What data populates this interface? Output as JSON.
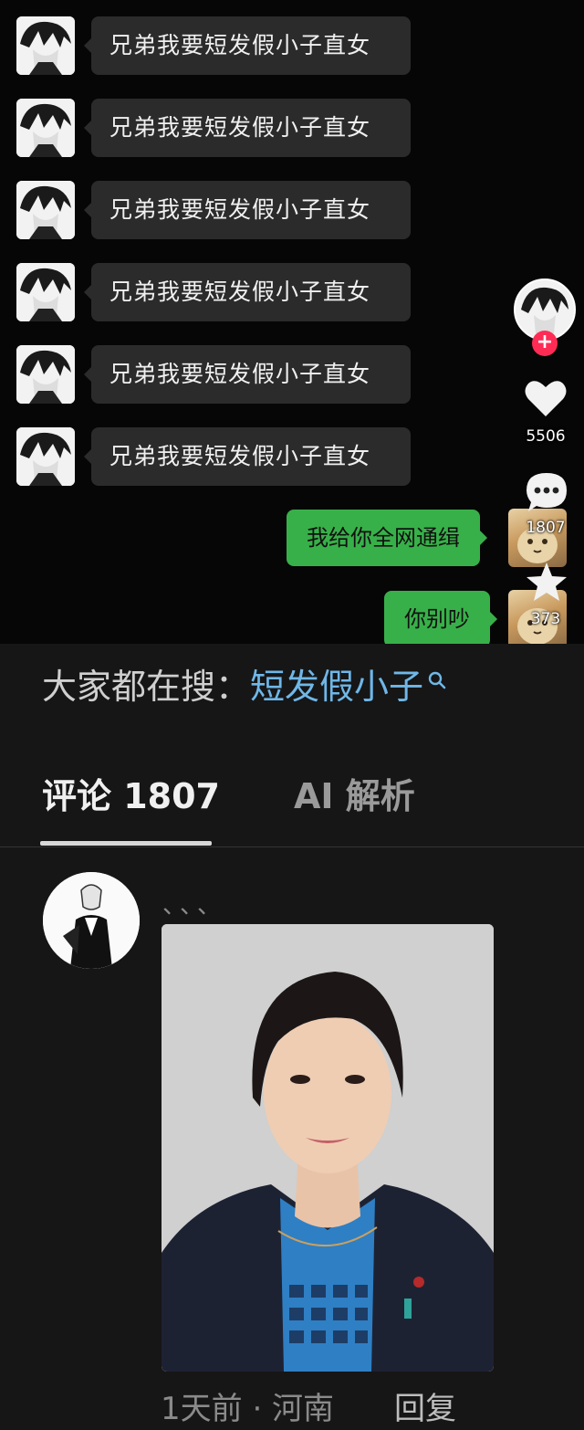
{
  "chat": {
    "left_messages": [
      {
        "text": "兄弟我要短发假小子直女"
      },
      {
        "text": "兄弟我要短发假小子直女"
      },
      {
        "text": "兄弟我要短发假小子直女"
      },
      {
        "text": "兄弟我要短发假小子直女"
      },
      {
        "text": "兄弟我要短发假小子直女"
      },
      {
        "text": "兄弟我要短发假小子直女"
      }
    ],
    "right_messages": [
      {
        "text": "我给你全网通缉"
      },
      {
        "text": "你别吵"
      }
    ]
  },
  "actions": {
    "follow_symbol": "+",
    "like_count": "5506",
    "comment_count": "1807",
    "favorite_count": "373",
    "like_icon": "heart-icon",
    "comment_icon": "comment-bubble-icon",
    "favorite_icon": "star-icon"
  },
  "search_suggestion": {
    "prefix": "大家都在搜：",
    "term": "短发假小子",
    "icon": "search-icon"
  },
  "tabs": {
    "comments": "评论 1807",
    "ai": "AI 解析"
  },
  "comment": {
    "username": "、、、",
    "meta": "1天前 · 河南",
    "reply": "回复"
  },
  "colors": {
    "accent_red": "#fe2c55",
    "self_bubble": "#38b049",
    "search_term": "#6fb7e8"
  }
}
